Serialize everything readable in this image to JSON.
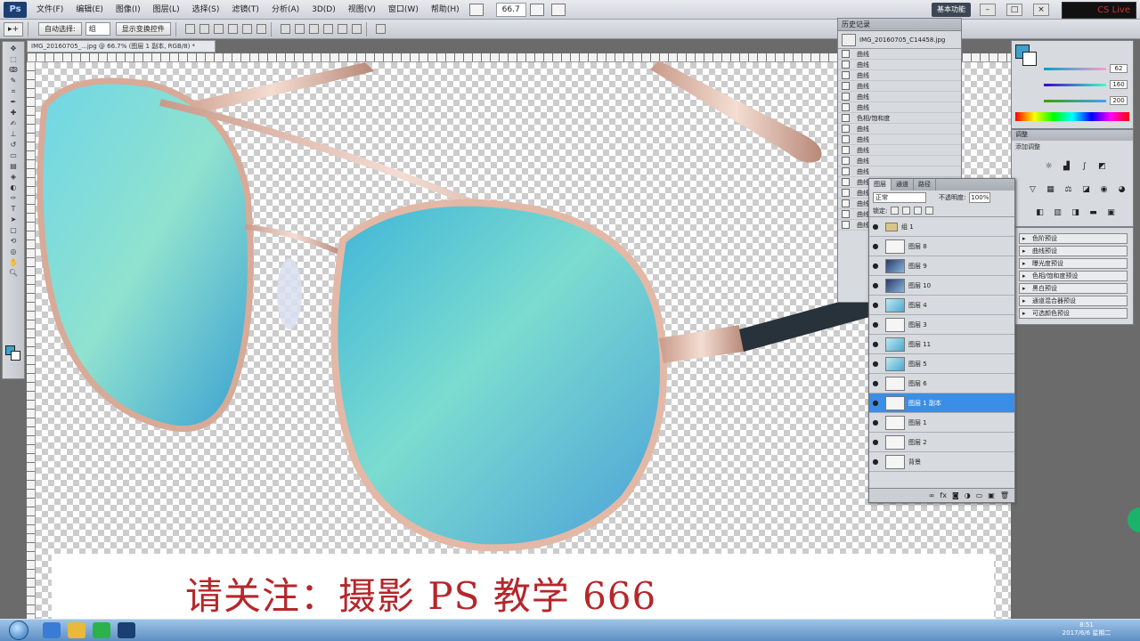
{
  "menubar": {
    "logo": "Ps",
    "items": [
      "文件(F)",
      "编辑(E)",
      "图像(I)",
      "图层(L)",
      "选择(S)",
      "滤镜(T)",
      "分析(A)",
      "3D(D)",
      "视图(V)",
      "窗口(W)",
      "帮助(H)"
    ],
    "zoom": "66.7",
    "workspace_button": "基本功能",
    "cs_live": "CS Live"
  },
  "options": {
    "auto_select_label": "自动选择:",
    "auto_select_value": "组",
    "show_transform_label": "显示变换控件"
  },
  "document": {
    "tab_title": "IMG_20160705_...jpg @ 66.7% (图层 1 副本, RGB/8) *"
  },
  "history": {
    "title": "历史记录",
    "snapshot": "IMG_20160705_C14458.jpg",
    "rows": [
      "曲线",
      "曲线",
      "曲线",
      "曲线",
      "曲线",
      "曲线",
      "色相/饱和度",
      "曲线",
      "曲线",
      "曲线",
      "曲线",
      "曲线",
      "曲线",
      "曲线",
      "曲线",
      "曲线",
      "曲线"
    ]
  },
  "color_panel": {
    "title": "颜色",
    "r": "62",
    "g": "160",
    "b": "200",
    "fg_color": "#3ea0c8"
  },
  "adjust_panel": {
    "title": "调整",
    "subtitle": "添加调整"
  },
  "presets": [
    "色阶预设",
    "曲线预设",
    "曝光度预设",
    "色相/饱和度预设",
    "黑白预设",
    "通道混合器预设",
    "可选颜色预设"
  ],
  "layers": {
    "tabs": [
      "图层",
      "通道",
      "路径"
    ],
    "blend_mode": "正常",
    "opacity_label": "不透明度:",
    "opacity": "100%",
    "lock_label": "锁定:",
    "rows": [
      {
        "name": "组 1",
        "kind": "group"
      },
      {
        "name": "图层 8",
        "kind": "plain"
      },
      {
        "name": "图层 9",
        "kind": "dark"
      },
      {
        "name": "图层 10",
        "kind": "dark"
      },
      {
        "name": "图层 4",
        "kind": "tint"
      },
      {
        "name": "图层 3",
        "kind": "plain"
      },
      {
        "name": "图层 11",
        "kind": "tint"
      },
      {
        "name": "图层 5",
        "kind": "tint"
      },
      {
        "name": "图层 6",
        "kind": "plain"
      },
      {
        "name": "图层 1 副本",
        "kind": "plain",
        "selected": true
      },
      {
        "name": "图层 1",
        "kind": "plain"
      },
      {
        "name": "图层 2",
        "kind": "plain"
      },
      {
        "name": "背景",
        "kind": "plain"
      }
    ]
  },
  "caption": "请关注：摄影 PS 教学 666",
  "tray": {
    "time": "8:51",
    "date": "2017/6/6 星期二"
  },
  "colors": {
    "accent": "#3a8ee6",
    "caption_red": "#b5272b",
    "lens": "#4fc3d9"
  }
}
